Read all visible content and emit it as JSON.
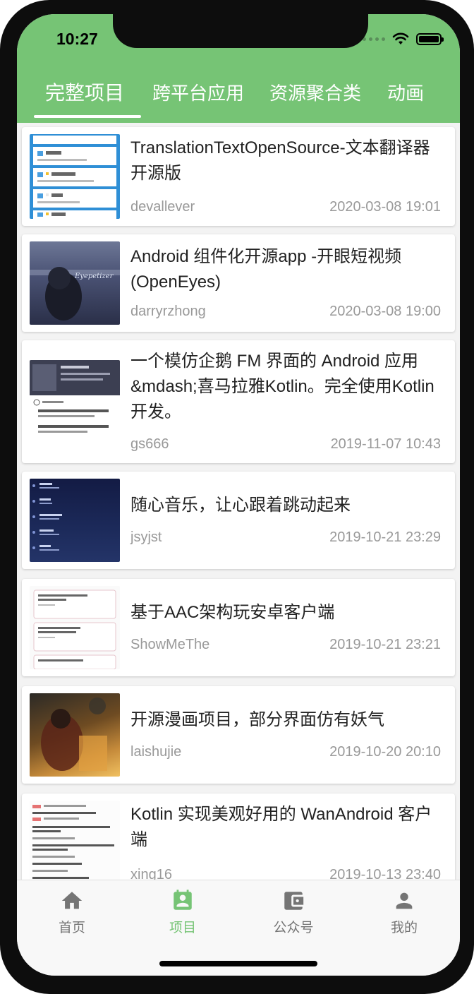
{
  "status": {
    "time": "10:27"
  },
  "tabs": [
    "完整项目",
    "跨平台应用",
    "资源聚合类",
    "动画"
  ],
  "articles": [
    {
      "title": "TranslationTextOpenSource-文本翻译器开源版",
      "author": "devallever",
      "date": "2020-03-08 19:01",
      "thumb": "translate-app-screenshot"
    },
    {
      "title": "Android 组件化开源app -开眼短视频(OpenEyes)",
      "author": "darryrzhong",
      "date": "2020-03-08 19:00",
      "thumb": "video-app-screenshot",
      "thumb_text": "Eyepetizer"
    },
    {
      "title": "一个模仿企鹅 FM 界面的 Android 应用&mdash;喜马拉雅Kotlin。完全使用Kotlin 开发。",
      "author": "gs666",
      "date": "2019-11-07 10:43",
      "thumb": "fm-app-screenshot"
    },
    {
      "title": "随心音乐，让心跟着跳动起来",
      "author": "jsyjst",
      "date": "2019-10-21 23:29",
      "thumb": "music-app-screenshot"
    },
    {
      "title": "基于AAC架构玩安卓客户端",
      "author": "ShowMeThe",
      "date": "2019-10-21 23:21",
      "thumb": "wanandroid-app-screenshot"
    },
    {
      "title": "开源漫画项目，部分界面仿有妖气",
      "author": "laishujie",
      "date": "2019-10-20 20:10",
      "thumb": "comic-app-screenshot"
    },
    {
      "title": "Kotlin 实现美观好用的 WanAndroid 客户端",
      "author": "xing16",
      "date": "2019-10-13 23:40",
      "thumb": "kotlin-wanandroid-screenshot"
    }
  ],
  "bottom_nav": [
    {
      "label": "首页",
      "icon": "home-icon"
    },
    {
      "label": "项目",
      "icon": "project-icon"
    },
    {
      "label": "公众号",
      "icon": "wallet-icon"
    },
    {
      "label": "我的",
      "icon": "person-icon"
    }
  ],
  "colors": {
    "primary": "#76c475",
    "text": "#222222",
    "meta": "#999999",
    "nav_inactive": "#757575"
  },
  "stray_glyph": ","
}
